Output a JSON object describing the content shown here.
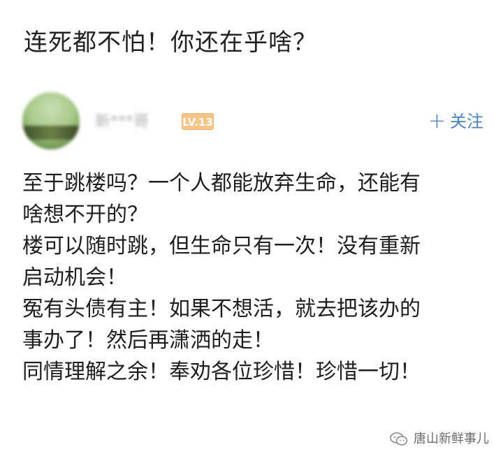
{
  "title": "连死都不怕！你还在乎啥？",
  "post": {
    "username": "新***哥",
    "level_badge": "LV.13",
    "follow_label": "关注",
    "follow_icon": "+",
    "lines": [
      "至于跳楼吗？一个人都能放弃生命，还能有",
      "啥想不开的？",
      "楼可以随时跳，但生命只有一次！没有重新",
      "启动机会！",
      "冤有头债有主！如果不想活，就去把该办的",
      "事办了！然后再潇洒的走！",
      "同情理解之余！奉劝各位珍惜！珍惜一切！"
    ]
  },
  "watermark": {
    "text": "唐山新鲜事儿",
    "icon": "wechat-icon"
  },
  "colors": {
    "follow": "#4c80bd",
    "badge": "#f7c58a",
    "text": "#1e1e1e"
  }
}
